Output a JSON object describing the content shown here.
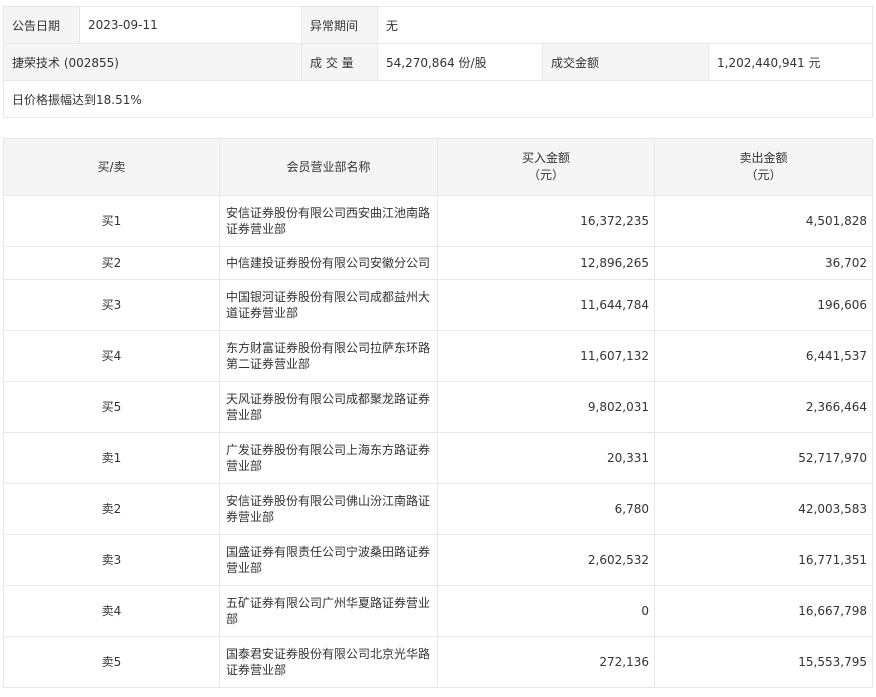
{
  "summary": {
    "announce_date_label": "公告日期",
    "announce_date": "2023-09-11",
    "abnormal_period_label": "异常期间",
    "abnormal_period": "无",
    "stock": "捷荣技术 (002855)",
    "volume_label": "成 交 量",
    "volume": "54,270,864 份/股",
    "turnover_label": "成交金额",
    "turnover": "1,202,440,941 元",
    "note": "日价格振幅达到18.51%"
  },
  "brokers": {
    "headers": {
      "side": "买/卖",
      "name": "会员营业部名称",
      "buy": "买入金额",
      "buy_unit": "（元）",
      "sell": "卖出金额",
      "sell_unit": "（元）"
    },
    "rows": [
      {
        "side": "买1",
        "name": "安信证券股份有限公司西安曲江池南路证券营业部",
        "buy": "16,372,235",
        "sell": "4,501,828"
      },
      {
        "side": "买2",
        "name": "中信建投证券股份有限公司安徽分公司",
        "buy": "12,896,265",
        "sell": "36,702"
      },
      {
        "side": "买3",
        "name": "中国银河证券股份有限公司成都益州大道证券营业部",
        "buy": "11,644,784",
        "sell": "196,606"
      },
      {
        "side": "买4",
        "name": "东方财富证券股份有限公司拉萨东环路第二证券营业部",
        "buy": "11,607,132",
        "sell": "6,441,537"
      },
      {
        "side": "买5",
        "name": "天风证券股份有限公司成都聚龙路证券营业部",
        "buy": "9,802,031",
        "sell": "2,366,464"
      },
      {
        "side": "卖1",
        "name": "广发证券股份有限公司上海东方路证券营业部",
        "buy": "20,331",
        "sell": "52,717,970"
      },
      {
        "side": "卖2",
        "name": "安信证券股份有限公司佛山汾江南路证券营业部",
        "buy": "6,780",
        "sell": "42,003,583"
      },
      {
        "side": "卖3",
        "name": "国盛证券有限责任公司宁波桑田路证券营业部",
        "buy": "2,602,532",
        "sell": "16,771,351"
      },
      {
        "side": "卖4",
        "name": "五矿证券有限公司广州华夏路证券营业部",
        "buy": "0",
        "sell": "16,667,798"
      },
      {
        "side": "卖5",
        "name": "国泰君安证券股份有限公司北京光华路证券营业部",
        "buy": "272,136",
        "sell": "15,553,795"
      }
    ]
  }
}
